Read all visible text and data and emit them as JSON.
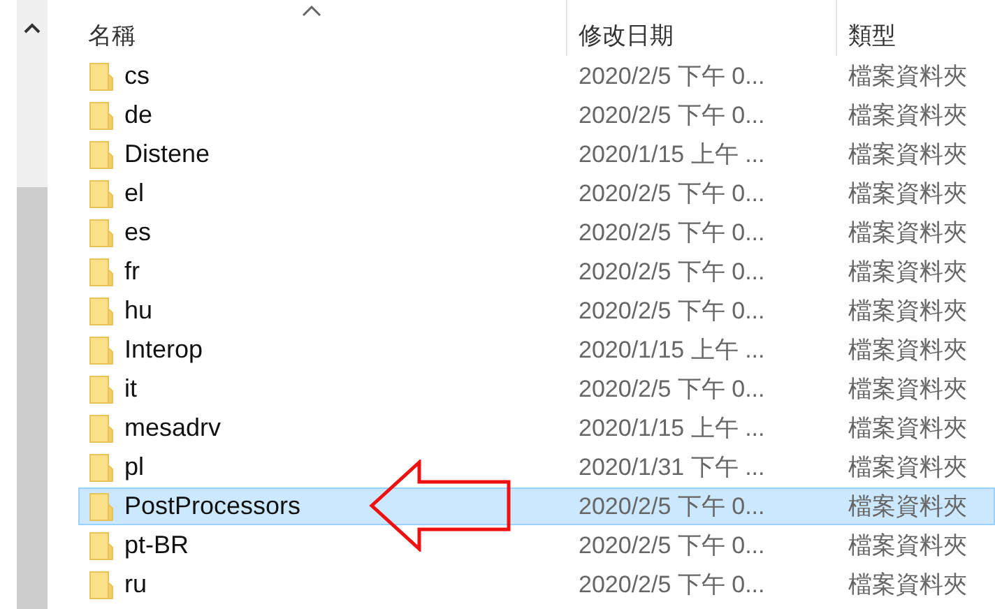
{
  "columns": [
    {
      "label": "名稱",
      "sorted": true
    },
    {
      "label": "修改日期",
      "sorted": false
    },
    {
      "label": "類型",
      "sorted": false
    }
  ],
  "rows": [
    {
      "name": "cs",
      "modified": "2020/2/5 下午 0...",
      "type": "檔案資料夾",
      "selected": false
    },
    {
      "name": "de",
      "modified": "2020/2/5 下午 0...",
      "type": "檔案資料夾",
      "selected": false
    },
    {
      "name": "Distene",
      "modified": "2020/1/15 上午 ...",
      "type": "檔案資料夾",
      "selected": false
    },
    {
      "name": "el",
      "modified": "2020/2/5 下午 0...",
      "type": "檔案資料夾",
      "selected": false
    },
    {
      "name": "es",
      "modified": "2020/2/5 下午 0...",
      "type": "檔案資料夾",
      "selected": false
    },
    {
      "name": "fr",
      "modified": "2020/2/5 下午 0...",
      "type": "檔案資料夾",
      "selected": false
    },
    {
      "name": "hu",
      "modified": "2020/2/5 下午 0...",
      "type": "檔案資料夾",
      "selected": false
    },
    {
      "name": "Interop",
      "modified": "2020/1/15 上午 ...",
      "type": "檔案資料夾",
      "selected": false
    },
    {
      "name": "it",
      "modified": "2020/2/5 下午 0...",
      "type": "檔案資料夾",
      "selected": false
    },
    {
      "name": "mesadrv",
      "modified": "2020/1/15 上午 ...",
      "type": "檔案資料夾",
      "selected": false
    },
    {
      "name": "pl",
      "modified": "2020/1/31 下午 ...",
      "type": "檔案資料夾",
      "selected": false
    },
    {
      "name": "PostProcessors",
      "modified": "2020/2/5 下午 0...",
      "type": "檔案資料夾",
      "selected": true
    },
    {
      "name": "pt-BR",
      "modified": "2020/2/5 下午 0...",
      "type": "檔案資料夾",
      "selected": false
    },
    {
      "name": "ru",
      "modified": "2020/2/5 下午 0...",
      "type": "檔案資料夾",
      "selected": false
    }
  ],
  "callout": {
    "kind": "arrow"
  }
}
